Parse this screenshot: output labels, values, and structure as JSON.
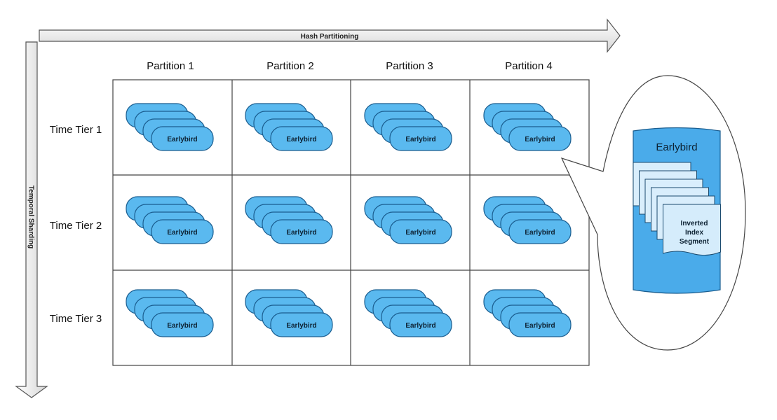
{
  "axes": {
    "horizontal_label": "Hash Partitioning",
    "vertical_label": "Temporal Sharding"
  },
  "columns": [
    "Partition 1",
    "Partition 2",
    "Partition 3",
    "Partition 4"
  ],
  "rows": [
    "Time Tier 1",
    "Time Tier 2",
    "Time Tier 3"
  ],
  "node_label": "Earlybird",
  "detail": {
    "title": "Earlybird",
    "segment_label_lines": [
      "Inverted",
      "Index",
      "Segment"
    ]
  },
  "colors": {
    "node_fill": "#5ab9ef",
    "node_stroke": "#1a5d8f",
    "detail_fill": "#4aabea",
    "grid_stroke": "#444444",
    "arrow_stroke": "#555555"
  }
}
